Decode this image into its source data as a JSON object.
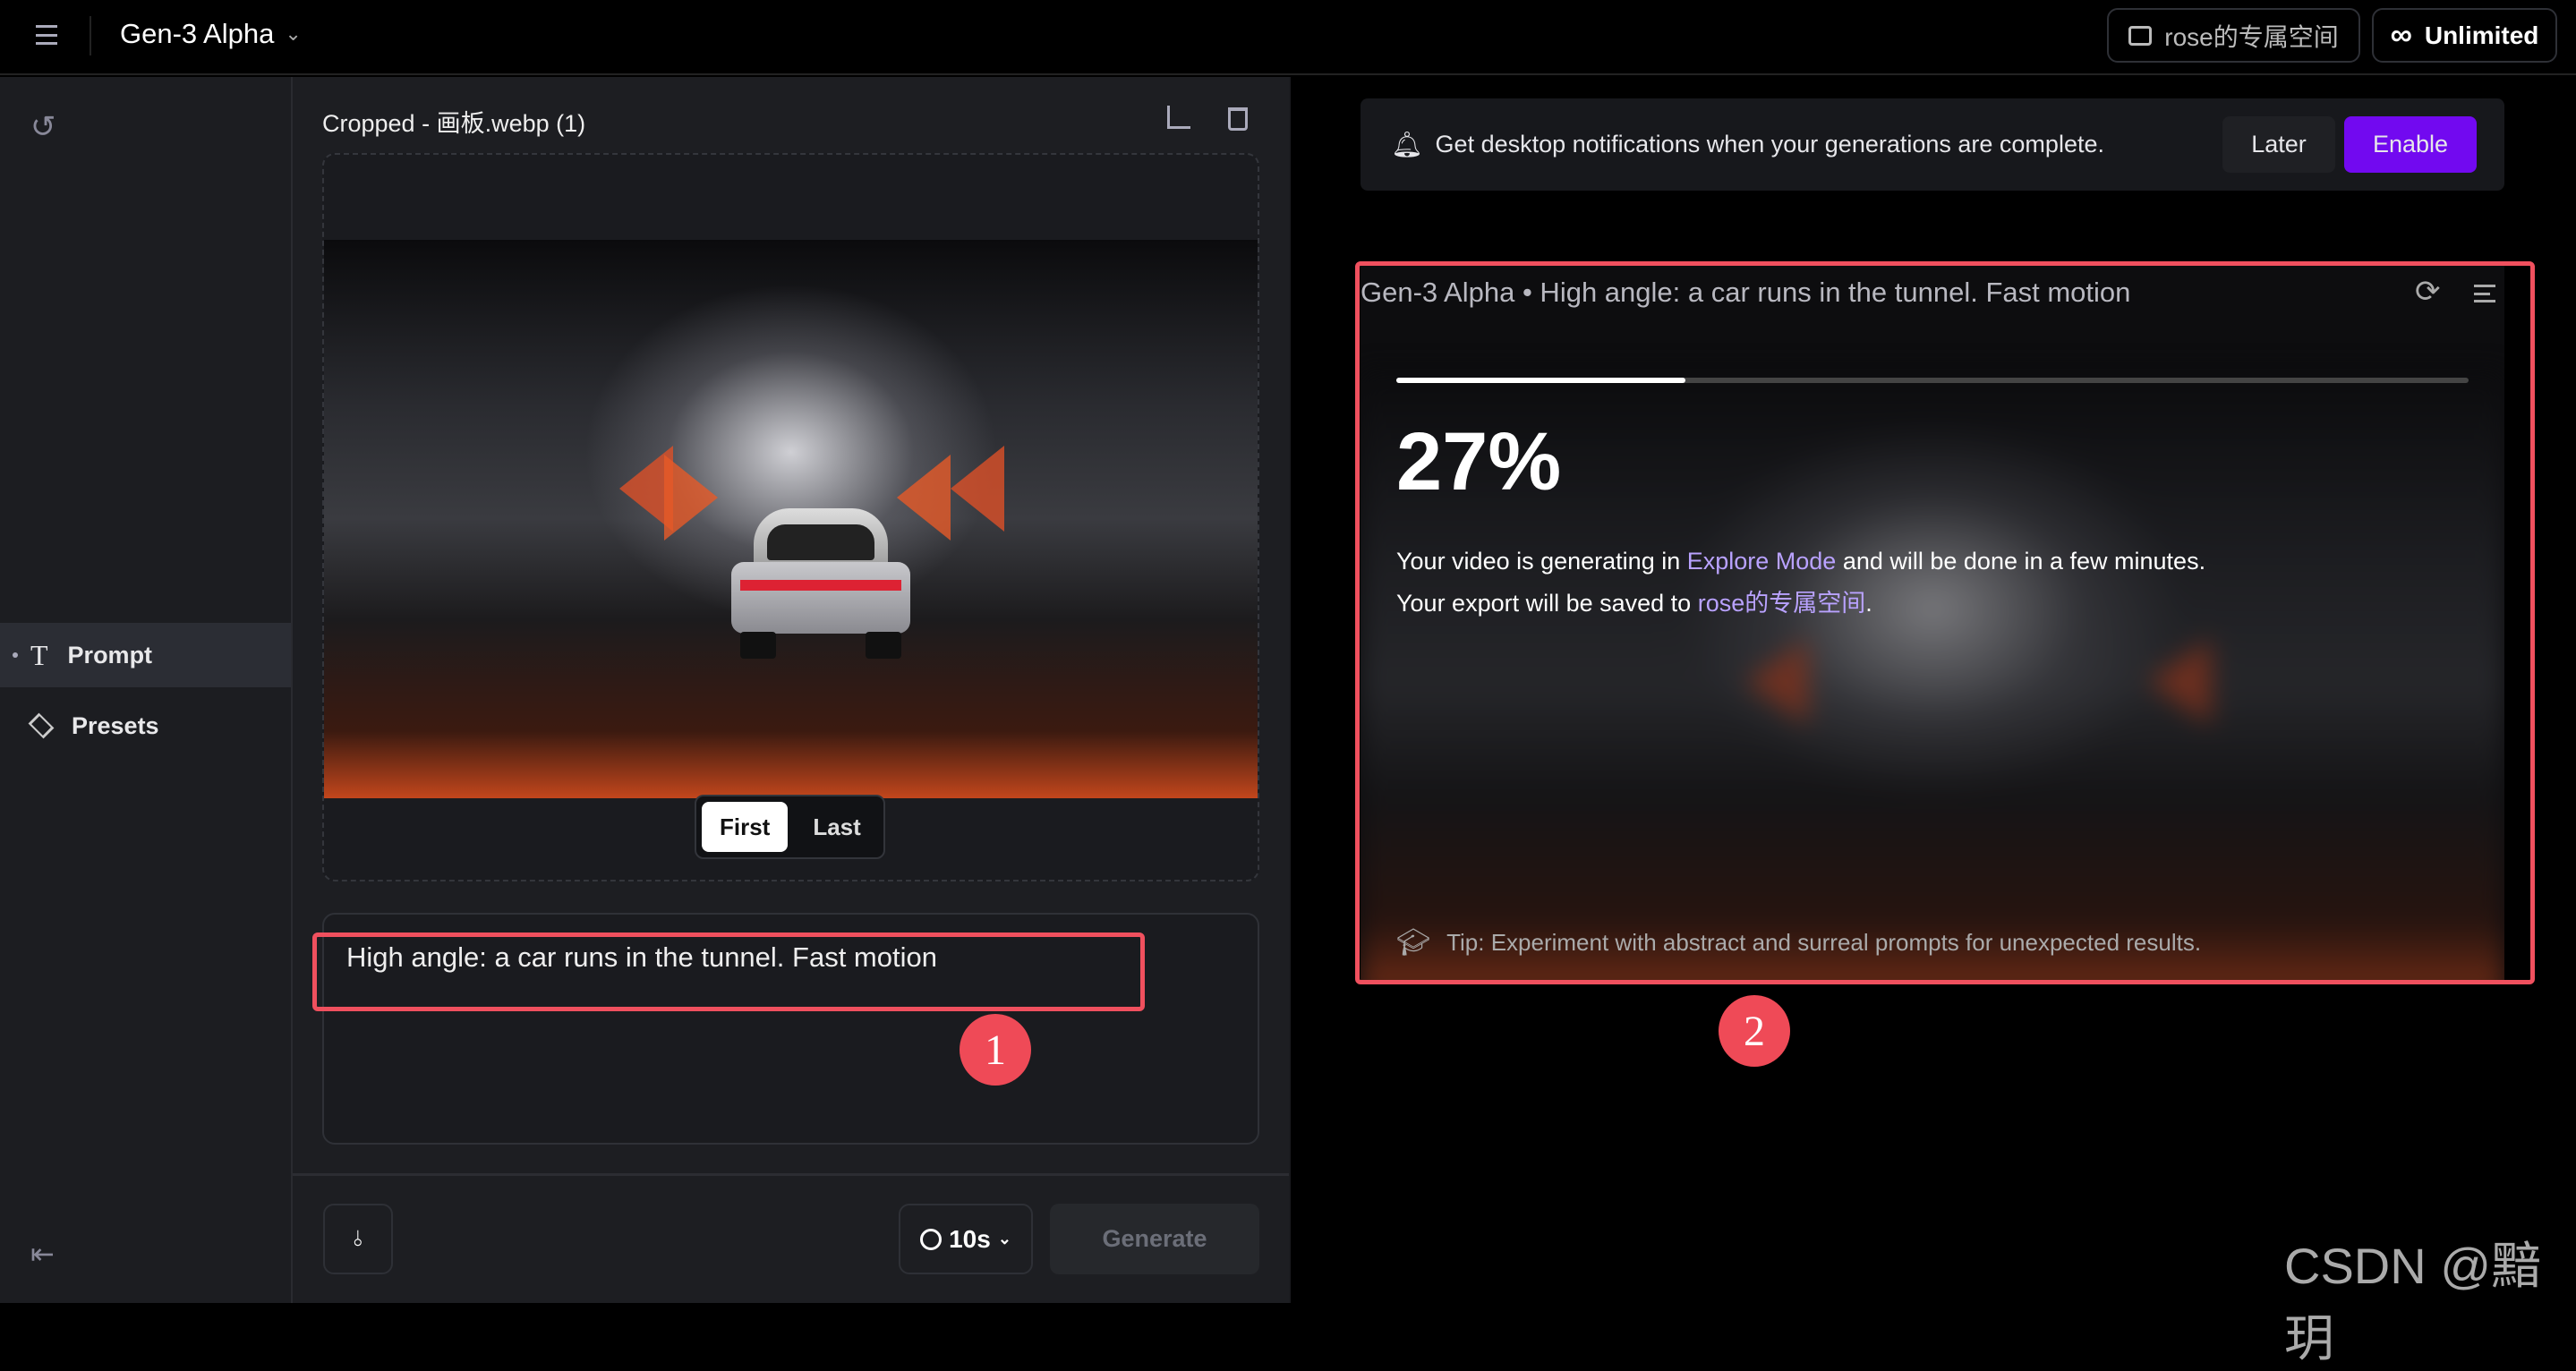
{
  "header": {
    "app_title": "Gen-3 Alpha",
    "workspace_label": "rose的专属空间",
    "plan_label": "Unlimited"
  },
  "sidebar": {
    "items": [
      {
        "label": "Prompt",
        "icon": "text-icon",
        "active": true
      },
      {
        "label": "Presets",
        "icon": "layers-icon",
        "active": false
      }
    ]
  },
  "editor": {
    "image_title": "Cropped - 画板.webp (1)",
    "frame_toggle": {
      "options": [
        "First",
        "Last"
      ],
      "selected": "First"
    },
    "prompt_text": "High angle: a car runs in the tunnel. Fast motion",
    "duration": "10s",
    "generate_label": "Generate"
  },
  "notification": {
    "message": "Get desktop notifications when your generations are complete.",
    "later_label": "Later",
    "enable_label": "Enable"
  },
  "generation": {
    "title": "Gen-3 Alpha • High angle: a car runs in the tunnel. Fast motion",
    "progress_percent": 27,
    "progress_text": "27%",
    "line1_pre": "Your video is generating in ",
    "line1_link": "Explore Mode",
    "line1_post": " and will be done in a few minutes.",
    "line2_pre": "Your export will be saved to ",
    "line2_link": "rose的专属空间",
    "line2_post": ".",
    "tip": "Tip: Experiment with abstract and surreal prompts for unexpected results."
  },
  "annotations": [
    "1",
    "2"
  ],
  "watermark": "CSDN @黯玥",
  "colors": {
    "accent": "#7209f0",
    "annotation": "#ef4a57",
    "link": "#b9a2ff"
  }
}
